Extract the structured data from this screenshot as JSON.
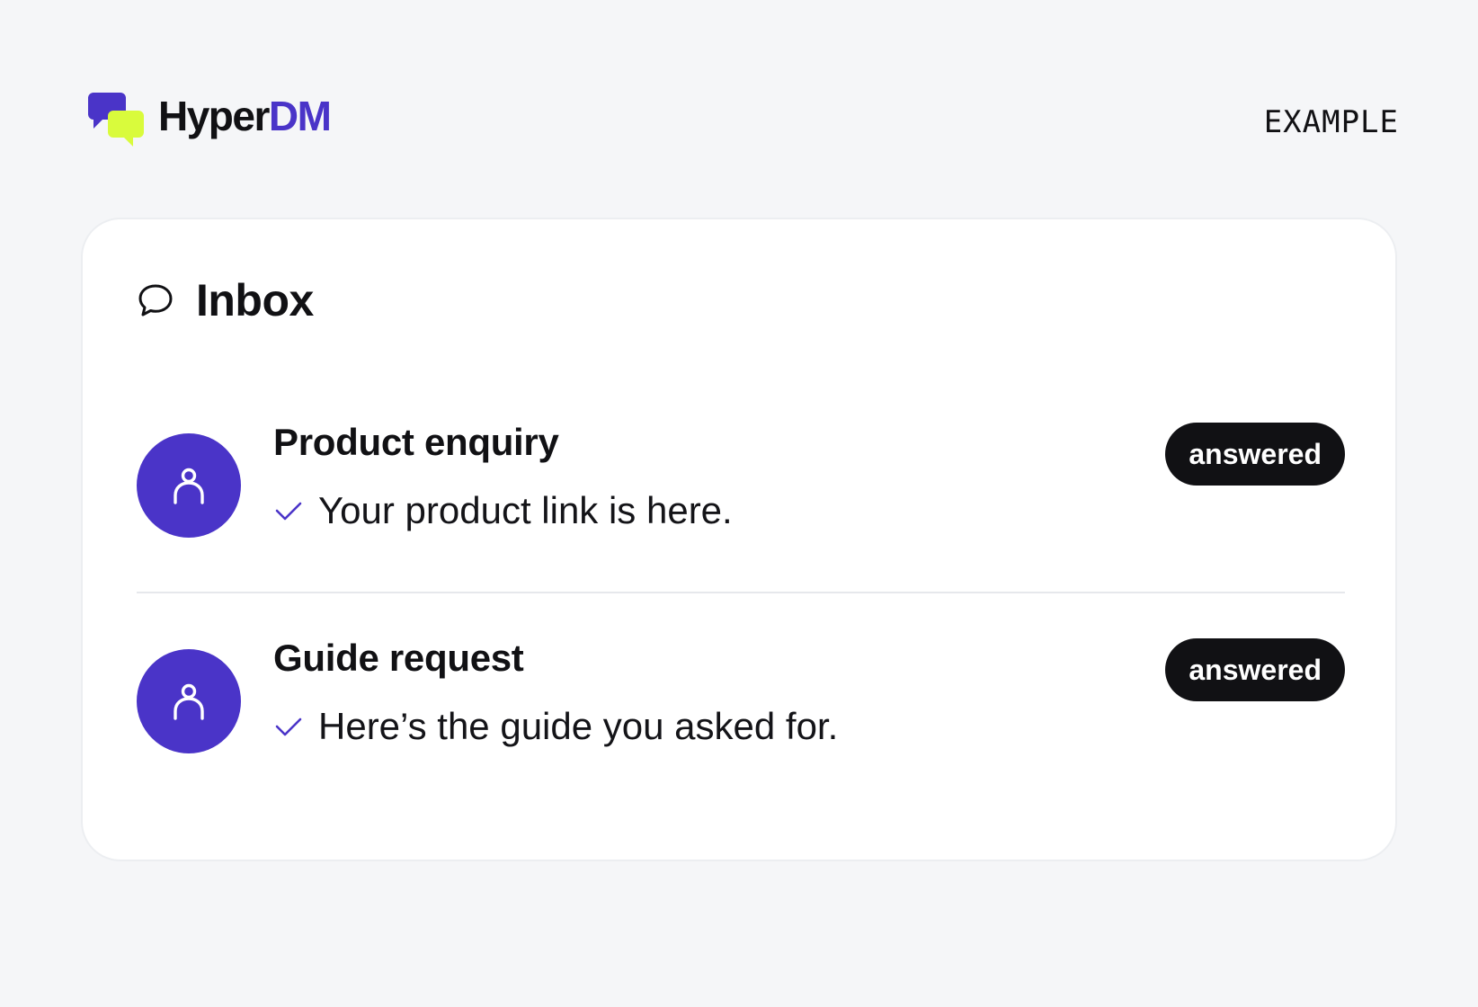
{
  "brand": {
    "name_part1": "Hyper",
    "name_part2": "DM",
    "logo_icon": "chat-bubbles-logo",
    "accent_color": "#4a34c8",
    "secondary_color": "#d9fb3c"
  },
  "header": {
    "tag": "EXAMPLE"
  },
  "inbox": {
    "icon": "chat-bubble-icon",
    "title": "Inbox",
    "threads": [
      {
        "avatar_icon": "user-icon",
        "subject": "Product enquiry",
        "status_icon": "check-icon",
        "preview": "Your product link is here.",
        "badge": "answered"
      },
      {
        "avatar_icon": "user-icon",
        "subject": "Guide request",
        "status_icon": "check-icon",
        "preview": "Here’s the guide you asked for.",
        "badge": "answered"
      }
    ]
  }
}
